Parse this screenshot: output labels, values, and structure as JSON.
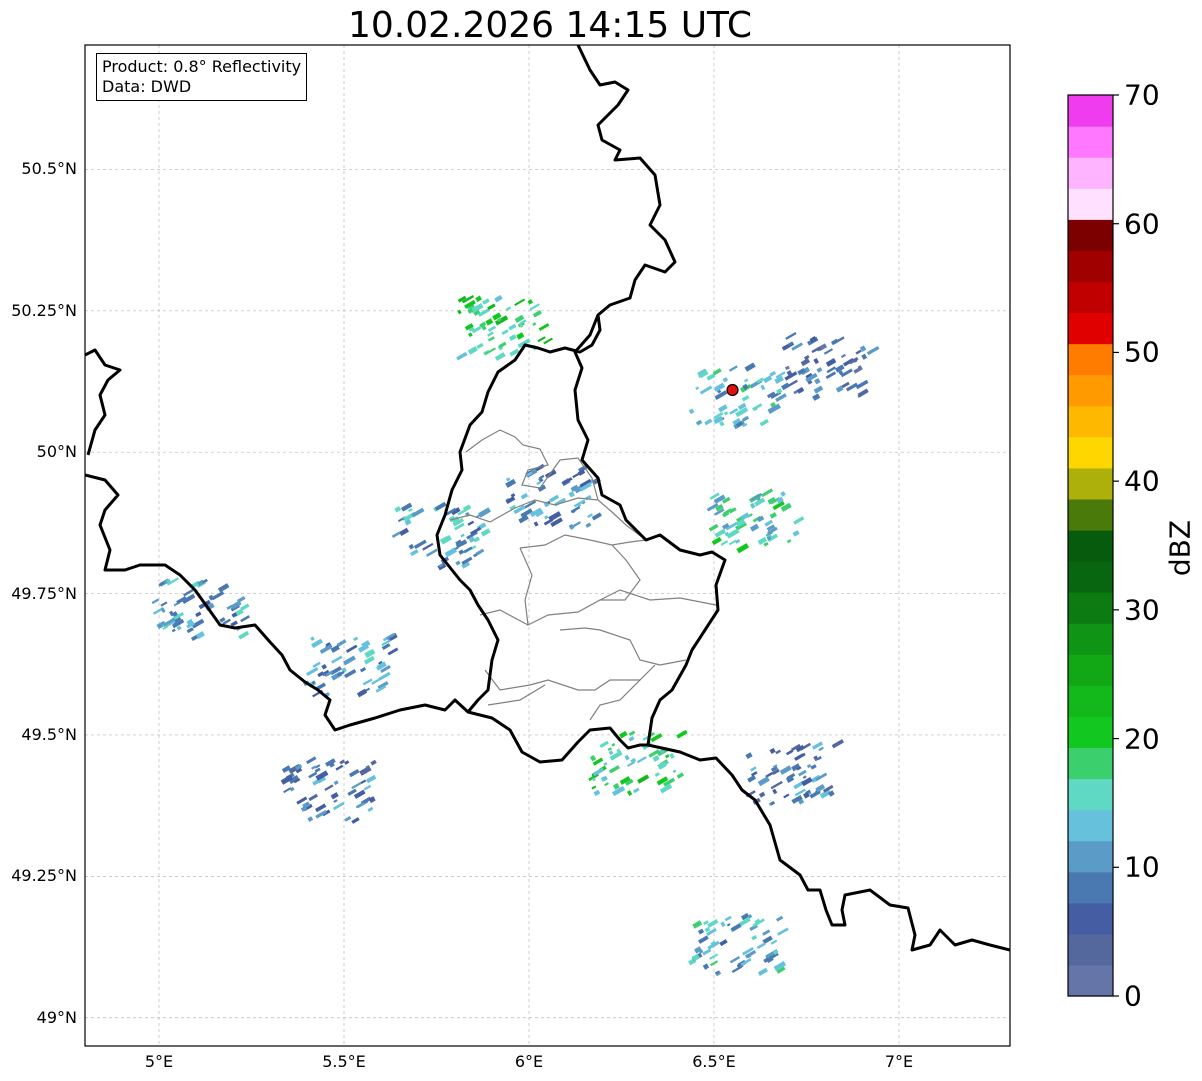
{
  "title": "10.02.2026 14:15 UTC",
  "info_box": {
    "product_line": "Product: 0.8° Reflectivity",
    "data_line": "Data: DWD"
  },
  "map": {
    "type": "radar reflectivity map",
    "extent": {
      "lon_min": 4.8,
      "lon_max": 7.3,
      "lat_min": 48.95,
      "lat_max": 50.72
    },
    "lat_ticks": [
      "50.5°N",
      "50.25°N",
      "50°N",
      "49.75°N",
      "49.5°N",
      "49.25°N",
      "49°N"
    ],
    "lat_values": [
      50.5,
      50.25,
      50.0,
      49.75,
      49.5,
      49.25,
      49.0
    ],
    "lon_ticks": [
      "5°E",
      "5.5°E",
      "6°E",
      "6.5°E",
      "7°E"
    ],
    "lon_values": [
      5.0,
      5.5,
      6.0,
      6.5,
      7.0
    ],
    "grid": true,
    "radar_site": {
      "lon": 6.55,
      "lat": 50.11,
      "marker_color": "#e01010"
    },
    "borders": [
      "Belgium",
      "Luxembourg",
      "Germany",
      "France",
      "Netherlands"
    ]
  },
  "colorbar": {
    "label": "dBZ",
    "tick_labels": [
      "0",
      "10",
      "20",
      "30",
      "40",
      "50",
      "60",
      "70"
    ],
    "tick_values": [
      0,
      10,
      20,
      30,
      40,
      50,
      60,
      70
    ],
    "min": 0,
    "max": 70,
    "colors": [
      "#6675a8",
      "#55689e",
      "#445da3",
      "#4a78b0",
      "#5a9cc7",
      "#66c2dc",
      "#5fd9c3",
      "#3ccf6e",
      "#12c820",
      "#13b81a",
      "#12a815",
      "#109415",
      "#0b7b12",
      "#086610",
      "#065b0d",
      "#4a7b0a",
      "#adb00a",
      "#ffd700",
      "#ffb800",
      "#ff9a00",
      "#ff7c00",
      "#e00000",
      "#c00000",
      "#a00000",
      "#7c0000",
      "#ffe0ff",
      "#ffb4ff",
      "#ff78ff",
      "#ee3cee"
    ]
  },
  "precip_cells": [
    {
      "lon": 5.1,
      "lat": 49.72,
      "dbz": 12
    },
    {
      "lon": 5.45,
      "lat": 49.4,
      "dbz": 10
    },
    {
      "lon": 5.5,
      "lat": 49.62,
      "dbz": 12
    },
    {
      "lon": 5.75,
      "lat": 49.85,
      "dbz": 13
    },
    {
      "lon": 5.92,
      "lat": 50.22,
      "dbz": 20
    },
    {
      "lon": 6.05,
      "lat": 49.92,
      "dbz": 11
    },
    {
      "lon": 6.28,
      "lat": 49.45,
      "dbz": 18
    },
    {
      "lon": 6.55,
      "lat": 50.1,
      "dbz": 14
    },
    {
      "lon": 6.8,
      "lat": 50.15,
      "dbz": 7
    },
    {
      "lon": 6.6,
      "lat": 49.88,
      "dbz": 16
    },
    {
      "lon": 6.7,
      "lat": 49.43,
      "dbz": 9
    },
    {
      "lon": 6.55,
      "lat": 49.13,
      "dbz": 13
    }
  ]
}
